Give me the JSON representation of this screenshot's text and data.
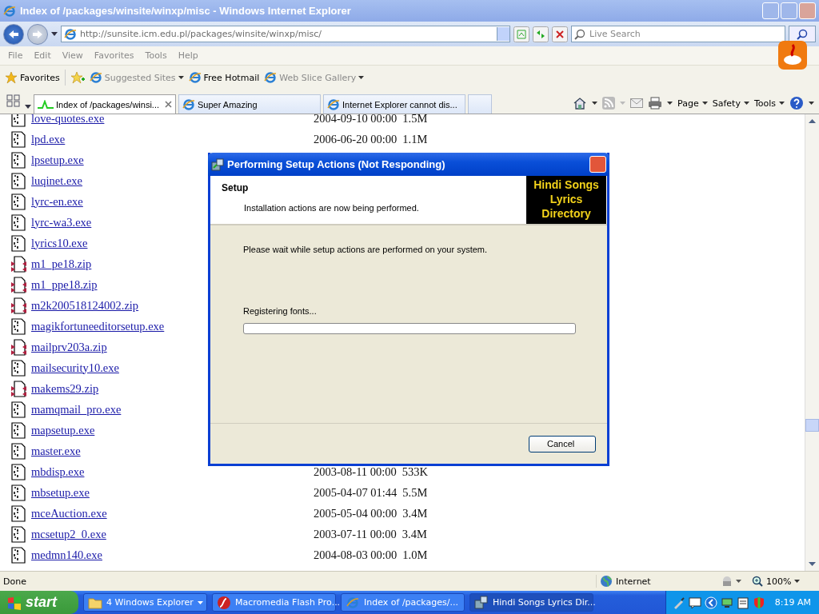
{
  "browser": {
    "title": "Index of /packages/winsite/winxp/misc - Windows Internet Explorer",
    "address": "http://sunsite.icm.edu.pl/packages/winsite/winxp/misc/",
    "search": {
      "placeholder": "Live Search"
    },
    "menu": [
      "File",
      "Edit",
      "View",
      "Favorites",
      "Tools",
      "Help"
    ],
    "favorites_bar": [
      {
        "label": "Favorites",
        "kind": "favorites",
        "disabled": false
      },
      {
        "label": "Suggested Sites",
        "kind": "dropdown",
        "disabled": true
      },
      {
        "label": "Free Hotmail",
        "kind": "link",
        "disabled": false
      },
      {
        "label": "Web Slice Gallery",
        "kind": "dropdown",
        "disabled": true
      }
    ],
    "tabs": [
      {
        "label": "Index of /packages/winsi...",
        "selected": true
      },
      {
        "label": "Super Amazing",
        "selected": false
      },
      {
        "label": "Internet Explorer cannot dis...",
        "selected": false
      }
    ],
    "command_bar": [
      "Page",
      "Safety",
      "Tools"
    ]
  },
  "listing": [
    {
      "kind": "exe",
      "name": "love-quotes.exe",
      "date": "2004-09-10 00:00",
      "size": "1.5M"
    },
    {
      "kind": "exe",
      "name": "lpd.exe",
      "date": "2006-06-20 00:00",
      "size": "1.1M"
    },
    {
      "kind": "exe",
      "name": "lpsetup.exe"
    },
    {
      "kind": "exe",
      "name": "luqinet.exe"
    },
    {
      "kind": "exe",
      "name": "lyrc-en.exe"
    },
    {
      "kind": "exe",
      "name": "lyrc-wa3.exe"
    },
    {
      "kind": "exe",
      "name": "lyrics10.exe"
    },
    {
      "kind": "zip",
      "name": "m1_pe18.zip"
    },
    {
      "kind": "zip",
      "name": "m1_ppe18.zip"
    },
    {
      "kind": "zip",
      "name": "m2k200518124002.zip"
    },
    {
      "kind": "exe",
      "name": "magikfortuneeditorsetup.exe"
    },
    {
      "kind": "zip",
      "name": "mailprv203a.zip"
    },
    {
      "kind": "exe",
      "name": "mailsecurity10.exe"
    },
    {
      "kind": "zip",
      "name": "makems29.zip"
    },
    {
      "kind": "exe",
      "name": "mamqmail_pro.exe"
    },
    {
      "kind": "exe",
      "name": "mapsetup.exe"
    },
    {
      "kind": "exe",
      "name": "master.exe"
    },
    {
      "kind": "exe",
      "name": "mbdisp.exe",
      "date": "2003-08-11 00:00",
      "size": "533K"
    },
    {
      "kind": "exe",
      "name": "mbsetup.exe",
      "date": "2005-04-07 01:44",
      "size": "5.5M"
    },
    {
      "kind": "exe",
      "name": "mceAuction.exe",
      "date": "2005-05-04 00:00",
      "size": "3.4M"
    },
    {
      "kind": "exe",
      "name": "mcsetup2_0.exe",
      "date": "2003-07-11 00:00",
      "size": "3.4M"
    },
    {
      "kind": "exe",
      "name": "medmn140.exe",
      "date": "2004-08-03 00:00",
      "size": "1.0M"
    }
  ],
  "dialog": {
    "title": "Performing Setup Actions (Not Responding)",
    "heading": "Setup",
    "subheading": "Installation actions are now being performed.",
    "logo": "Hindi Songs Lyrics Directory",
    "message": "Please wait while setup actions are performed on your system.",
    "status": "Registering fonts...",
    "progress": {
      "level": 0
    },
    "button": "Cancel"
  },
  "status_bar": {
    "text": "Done",
    "zone": "Internet",
    "zoom": "100%"
  },
  "taskbar": {
    "start": "start",
    "items": [
      {
        "label": "4 Windows Explorer",
        "kind": "group",
        "selected": false
      },
      {
        "label": "Macromedia Flash Pro...",
        "kind": "flash",
        "selected": false
      },
      {
        "label": "Index of /packages/...",
        "kind": "ie",
        "selected": false
      },
      {
        "label": "Hindi Songs Lyrics Dir...",
        "kind": "setup",
        "selected": true
      }
    ],
    "clock": "8:19 AM"
  }
}
